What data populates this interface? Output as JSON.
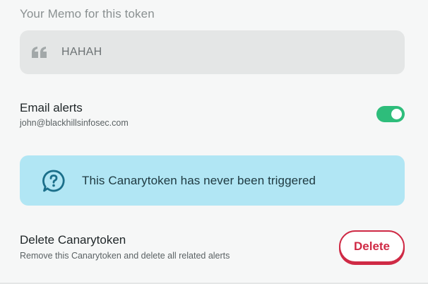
{
  "memo": {
    "heading": "Your Memo for this token",
    "value": "HAHAH",
    "icon": "quote-icon"
  },
  "email_alerts": {
    "title": "Email alerts",
    "address": "john@blackhillsinfosec.com",
    "enabled": true,
    "toggle_color": "#2ebd7b"
  },
  "status": {
    "message": "This Canarytoken has never been triggered",
    "icon": "question-bubble-icon",
    "background": "#b1e6f4"
  },
  "delete": {
    "title": "Delete Canarytoken",
    "description": "Remove this Canarytoken and delete all related alerts",
    "button_label": "Delete",
    "accent": "#cf2a45"
  }
}
